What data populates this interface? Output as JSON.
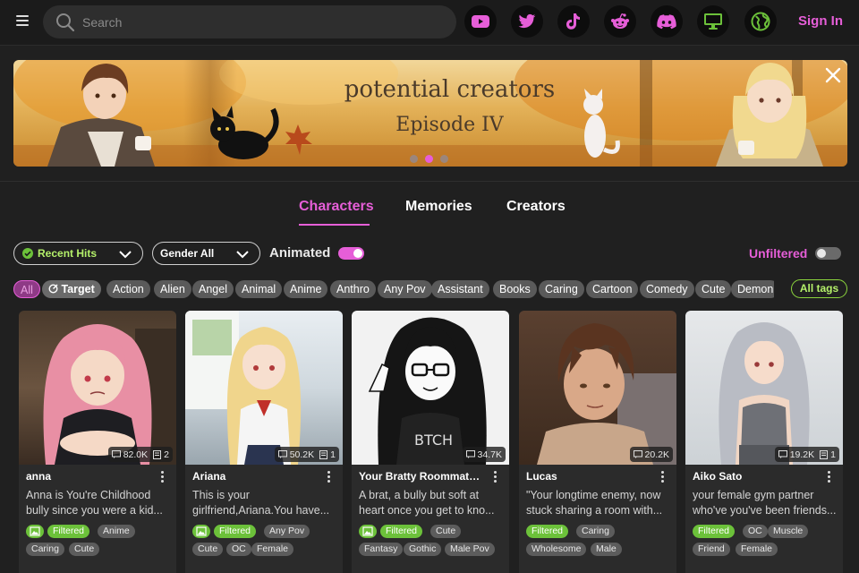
{
  "header": {
    "search_placeholder": "Search",
    "social_icons": [
      "youtube-icon",
      "twitter-icon",
      "tiktok-icon",
      "reddit-icon",
      "discord-icon",
      "desktop-icon",
      "globe-icon"
    ],
    "sign_in": "Sign In"
  },
  "banner": {
    "title_line1": "potential creators",
    "title_line2": "Episode IV",
    "slides": 3,
    "active_slide": 2
  },
  "tabs": [
    {
      "label": "Characters",
      "active": true
    },
    {
      "label": "Memories",
      "active": false
    },
    {
      "label": "Creators",
      "active": false
    }
  ],
  "filters": {
    "sort_label": "Recent Hits",
    "gender_label": "Gender All",
    "animated_label": "Animated",
    "animated_on": true,
    "unfiltered_label": "Unfiltered",
    "unfiltered_on": false
  },
  "tags": [
    "All",
    "Target",
    "Action",
    "Alien",
    "Angel",
    "Animal",
    "Anime",
    "Anthro",
    "Any Pov",
    "Assistant",
    "Books",
    "Caring",
    "Cartoon",
    "Comedy",
    "Cute",
    "Demon"
  ],
  "all_tags_label": "All tags",
  "colors": {
    "accent": "#e65ed8",
    "green": "#6cc13a",
    "background": "#202020"
  },
  "cards": [
    {
      "name": "anna",
      "chats": "82.0K",
      "memories": "2",
      "desc": [
        "Anna is You're Childhood",
        "bully since you were a kid..."
      ],
      "tags": [
        [
          "img",
          "Filtered",
          "Anime"
        ],
        [
          "Caring",
          "Cute"
        ]
      ]
    },
    {
      "name": "Ariana",
      "chats": "50.2K",
      "memories": "1",
      "desc": [
        "This is your",
        "girlfriend,Ariana.You have..."
      ],
      "tags": [
        [
          "img",
          "Filtered",
          "Any Pov"
        ],
        [
          "Cute",
          "OC",
          "Female"
        ]
      ]
    },
    {
      "name": "Your Bratty Roommate (...",
      "chats": "34.7K",
      "memories": "",
      "desc": [
        "A brat, a bully but soft at",
        "heart once you get to kno..."
      ],
      "tags": [
        [
          "img",
          "Filtered",
          "Cute"
        ],
        [
          "Fantasy",
          "Gothic",
          "Male Pov"
        ]
      ]
    },
    {
      "name": "Lucas",
      "chats": "20.2K",
      "memories": "",
      "desc": [
        "\"Your longtime enemy, now",
        "stuck sharing a room with..."
      ],
      "tags": [
        [
          "Filtered",
          "Caring"
        ],
        [
          "Wholesome",
          "Male"
        ]
      ]
    },
    {
      "name": "Aiko Sato",
      "chats": "19.2K",
      "memories": "1",
      "desc": [
        "your female gym partner",
        "who've you've been friends..."
      ],
      "tags": [
        [
          "Filtered",
          "OC",
          "Muscle"
        ],
        [
          "Friend",
          "Female"
        ]
      ]
    }
  ]
}
